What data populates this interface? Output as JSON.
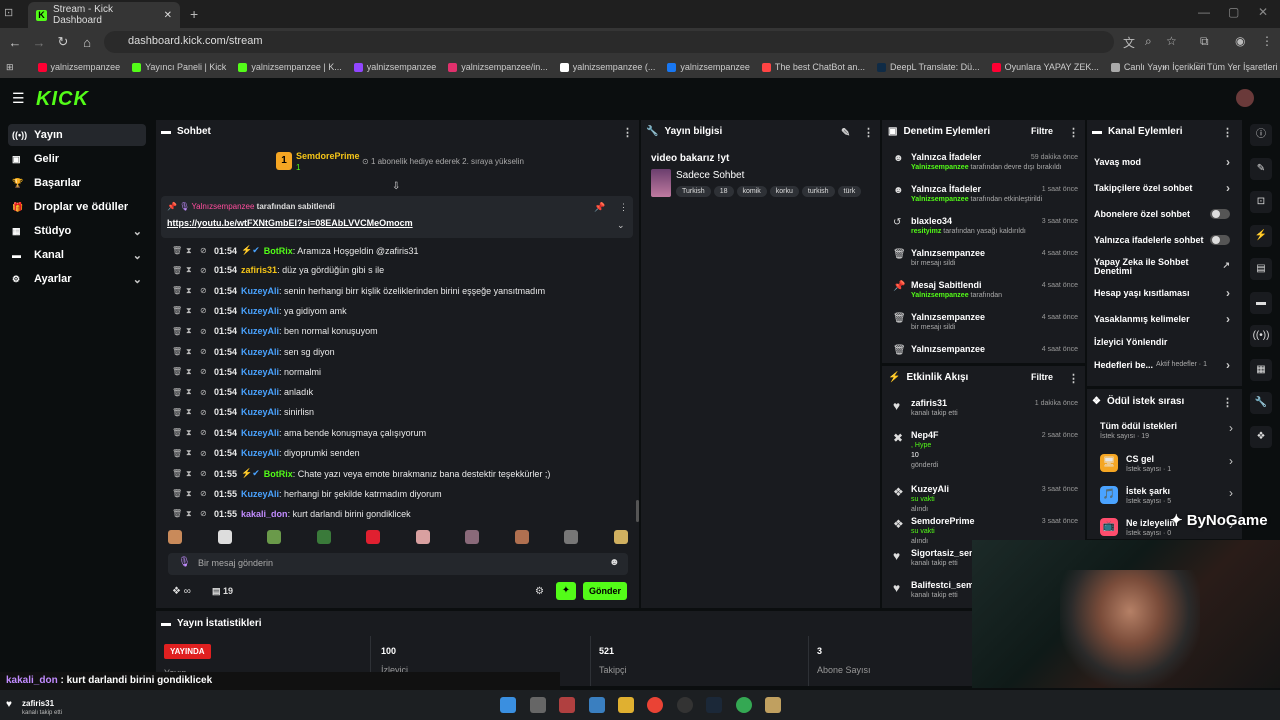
{
  "browser": {
    "tab_title": "Stream - Kick Dashboard",
    "url": "dashboard.kick.com/stream",
    "bookmarks": [
      {
        "label": "yalnizsempanzee",
        "color": "#ff0033"
      },
      {
        "label": "Yayıncı Paneli | Kick",
        "color": "#53fc18"
      },
      {
        "label": "yalnizsempanzee | K...",
        "color": "#53fc18"
      },
      {
        "label": "yalnizsempanzee",
        "color": "#9146ff"
      },
      {
        "label": "yalnizsempanzee/in...",
        "color": "#e1306c"
      },
      {
        "label": "yalnizsempanzee (...",
        "color": "#ffffff"
      },
      {
        "label": "yalnizsempanzee",
        "color": "#1877f2"
      },
      {
        "label": "The best ChatBot an...",
        "color": "#ff4444"
      },
      {
        "label": "DeepL Translate: Dü...",
        "color": "#0f2b46"
      },
      {
        "label": "Oyunlara YAPAY ZEK...",
        "color": "#ff0033"
      },
      {
        "label": "Canlı Yayın İçerikleri",
        "color": "#aaaaaa"
      }
    ],
    "all_bookmarks": "Tüm Yer İşaretleri"
  },
  "header": {
    "logo": "KICK"
  },
  "sidebar": {
    "items": [
      {
        "label": "Yayın",
        "icon": "stream-icon"
      },
      {
        "label": "Gelir",
        "icon": "revenue-icon"
      },
      {
        "label": "Başarılar",
        "icon": "trophy-icon"
      },
      {
        "label": "Droplar ve ödüller",
        "icon": "gift-icon"
      },
      {
        "label": "Stüdyo",
        "icon": "studio-icon"
      },
      {
        "label": "Kanal",
        "icon": "channel-icon"
      },
      {
        "label": "Ayarlar",
        "icon": "gear-icon"
      }
    ]
  },
  "chat": {
    "title": "Sohbet",
    "gift_user": "SemdorePrime",
    "gift_count": "1",
    "gift_text": "1 abonelik hediye ederek 2. sıraya yükselin",
    "pinned_by": "Yalnızsempanzee",
    "pinned_suffix": "tarafından sabitlendi",
    "pinned_link": "https://youtu.be/wtFXNtGmbEI?si=08EAbLVVCMeOmocm",
    "messages": [
      {
        "time": "01:54",
        "user": "BotRix",
        "color": "#53fc18",
        "text": ": Aramıza Hoşgeldin @zafiris31"
      },
      {
        "time": "01:54",
        "user": "zafiris31",
        "color": "#f5c518",
        "text": ": düz ya gördüğün gibi s ile"
      },
      {
        "time": "01:54",
        "user": "KuzeyAli",
        "color": "#4aa3ff",
        "text": ": senin herhangi birr kişlik özeliklerinden birini eşşeğe yansıtmadım"
      },
      {
        "time": "01:54",
        "user": "KuzeyAli",
        "color": "#4aa3ff",
        "text": ": ya gidiyom amk"
      },
      {
        "time": "01:54",
        "user": "KuzeyAli",
        "color": "#4aa3ff",
        "text": ": ben normal konuşuyom"
      },
      {
        "time": "01:54",
        "user": "KuzeyAli",
        "color": "#4aa3ff",
        "text": ": sen sg diyon"
      },
      {
        "time": "01:54",
        "user": "KuzeyAli",
        "color": "#4aa3ff",
        "text": ": normalmi"
      },
      {
        "time": "01:54",
        "user": "KuzeyAli",
        "color": "#4aa3ff",
        "text": ": anladık"
      },
      {
        "time": "01:54",
        "user": "KuzeyAli",
        "color": "#4aa3ff",
        "text": ": sinirlisn"
      },
      {
        "time": "01:54",
        "user": "KuzeyAli",
        "color": "#4aa3ff",
        "text": ": ama bende konuşmaya çalışıyorum"
      },
      {
        "time": "01:54",
        "user": "KuzeyAli",
        "color": "#4aa3ff",
        "text": ": diyoprumki senden"
      },
      {
        "time": "01:55",
        "user": "BotRix",
        "color": "#53fc18",
        "text": ": Chate yazı veya emote bırakmanız bana destektir teşekkürler ;)"
      },
      {
        "time": "01:55",
        "user": "KuzeyAli",
        "color": "#4aa3ff",
        "text": ": herhangi bir şekilde katrmadım diyorum"
      },
      {
        "time": "01:55",
        "user": "kakali_don",
        "color": "#c28cff",
        "text": ": kurt darlandi birini gondiklicek"
      }
    ],
    "input_placeholder": "Bir mesaj gönderin",
    "infinity": "∞",
    "viewer_count": "19",
    "send_label": "Gönder"
  },
  "stream_info": {
    "title": "Yayın bilgisi",
    "stream_title": "video bakarız !yt",
    "category": "Sadece Sohbet",
    "tags": [
      "Turkish",
      "18",
      "komik",
      "korku",
      "turkish",
      "türk"
    ]
  },
  "moderation": {
    "title": "Denetim Eylemleri",
    "filter": "Filtre",
    "rows": [
      {
        "title": "Yalnızca İfadeler",
        "sub_name": "Yalnizsempanzee",
        "sub_text": " tarafından devre dışı bırakıldı",
        "when": "59 dakika önce",
        "icon": "☻"
      },
      {
        "title": "Yalnızca İfadeler",
        "sub_name": "Yalnizsempanzee",
        "sub_text": " tarafından etkinleştirildi",
        "when": "1 saat önce",
        "icon": "☻"
      },
      {
        "title": "blaxleo34",
        "sub_name": "resityimz",
        "sub_text": " tarafından yasağı kaldırıldı",
        "when": "3 saat önce",
        "icon": "↺"
      },
      {
        "title": "Yalnızsempanzee",
        "sub_name": "",
        "sub_text": "bir mesajı sildi",
        "when": "4 saat önce",
        "icon": "🗑"
      },
      {
        "title": "Mesaj Sabitlendi",
        "sub_name": "Yalnizsempanzee",
        "sub_text": " tarafından",
        "when": "4 saat önce",
        "icon": "📌"
      },
      {
        "title": "Yalnızsempanzee",
        "sub_name": "",
        "sub_text": "bir mesajı sildi",
        "when": "4 saat önce",
        "icon": "🗑"
      },
      {
        "title": "Yalnızsempanzee",
        "sub_name": "",
        "sub_text": "",
        "when": "4 saat önce",
        "icon": "🗑"
      }
    ]
  },
  "activity": {
    "title": "Etkinlik Akışı",
    "filter": "Filtre",
    "rows": [
      {
        "title": "zafiris31",
        "sub": "kanalı takip etti",
        "when": "1 dakika önce",
        "icon": "♥"
      },
      {
        "title": "Nep4F",
        "sub": ", Hype",
        "extra": "10",
        "sub2": "gönderdi",
        "when": "2 saat önce",
        "icon": "✖"
      },
      {
        "title": "KuzeyAli",
        "sub": "su vakti",
        "sub2": "alındı",
        "when": "3 saat önce",
        "icon": "❖"
      },
      {
        "title": "SemdorePrime",
        "sub": "su vakti",
        "sub2": "alındı",
        "when": "3 saat önce",
        "icon": "❖"
      },
      {
        "title": "Sigortasiz_sem",
        "sub": "kanalı takip etti",
        "when": "",
        "icon": "♥"
      },
      {
        "title": "Balifestci_semp",
        "sub": "kanalı takip etti",
        "when": "",
        "icon": "♥"
      }
    ]
  },
  "channel": {
    "title": "Kanal Eylemleri",
    "rows": [
      {
        "label": "Yavaş mod",
        "type": "chevron"
      },
      {
        "label": "Takipçilere özel sohbet",
        "type": "chevron"
      },
      {
        "label": "Abonelere özel sohbet",
        "type": "toggle"
      },
      {
        "label": "Yalnızca ifadelerle sohbet",
        "type": "toggle"
      },
      {
        "label": "Yapay Zeka ile Sohbet Denetimi",
        "type": "external"
      },
      {
        "label": "Hesap yaşı kısıtlaması",
        "type": "chevron"
      },
      {
        "label": "Yasaklanmış kelimeler",
        "type": "chevron"
      },
      {
        "label": "İzleyici Yönlendir",
        "type": "none"
      },
      {
        "label": "Hedefleri be...",
        "type": "chevron",
        "badge": "Aktif hedefler · 1"
      }
    ]
  },
  "rewards": {
    "title": "Ödül istek sırası",
    "rows": [
      {
        "title": "Tüm ödül istekleri",
        "sub": "İstek sayısı · 19",
        "color": ""
      },
      {
        "title": "CS gel",
        "sub": "İstek sayısı · 1",
        "color": "#f5a623"
      },
      {
        "title": "İstek şarkı",
        "sub": "İstek sayısı · 5",
        "color": "#4aa3ff"
      },
      {
        "title": "Ne izleyelim",
        "sub": "İstek sayısı · 0",
        "color": "#ff4d6d"
      }
    ]
  },
  "stats": {
    "title": "Yayın İstatistikleri",
    "live_badge": "YAYINDA",
    "live_label": "Yayın",
    "viewers": "100",
    "viewers_label": "İzleyici",
    "followers": "521",
    "followers_label": "Takipçi",
    "subs": "3",
    "subs_label": "Abone Sayısı"
  },
  "overlay": {
    "chat_user": "kakali_don",
    "chat_text": " : kurt darlandi birini gondiklicek",
    "follow_user": "zafiris31",
    "follow_text": "kanalı takip etti",
    "watermark": "ByNoGame"
  }
}
